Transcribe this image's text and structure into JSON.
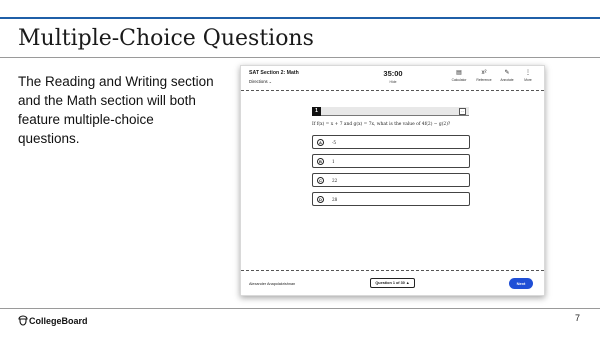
{
  "slide": {
    "title": "Multiple-Choice Questions",
    "body": "The Reading and Writing section and the Math section will both feature multiple-choice questions.",
    "logo_text": "CollegeBoard",
    "logo_icon": "acorn-icon",
    "page_number": "7",
    "accent_color": "#1f5fa8"
  },
  "app": {
    "section_title": "SAT Section 2: Math",
    "directions_label": "Directions",
    "timer": "35:00",
    "hide_label": "Hide",
    "tools": [
      {
        "label": "Calculator",
        "icon": "calculator-icon"
      },
      {
        "label": "Reference",
        "icon": "reference-icon"
      },
      {
        "label": "Annotate",
        "icon": "pencil-icon"
      },
      {
        "label": "More",
        "icon": "more-vertical-icon"
      }
    ],
    "question": {
      "number": "1",
      "text": "If f(x) = x + 7 and g(x) = 7x, what is the value of 4f(2) − g(2)?",
      "choices": [
        {
          "letter": "A",
          "text": "-5"
        },
        {
          "letter": "B",
          "text": "1"
        },
        {
          "letter": "C",
          "text": "22"
        },
        {
          "letter": "D",
          "text": "28"
        }
      ]
    },
    "footer": {
      "student_name": "Alexander Anapolakrishnan",
      "question_nav": "Question 1 of 30",
      "next_label": "Next",
      "next_color": "#1f4fd6"
    }
  }
}
